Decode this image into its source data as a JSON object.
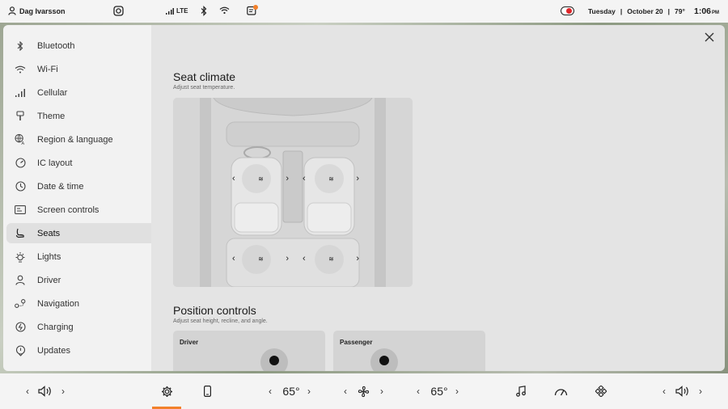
{
  "status": {
    "user": "Dag Ivarsson",
    "signal": "LTE",
    "date_day": "Tuesday",
    "date_sep1": "|",
    "date": "October 20",
    "date_sep2": "|",
    "temp": "79°",
    "time": "1:06",
    "time_suffix": "PM"
  },
  "sidebar": {
    "items": [
      {
        "label": "Bluetooth",
        "icon": "bluetooth-icon"
      },
      {
        "label": "Wi-Fi",
        "icon": "wifi-icon"
      },
      {
        "label": "Cellular",
        "icon": "cellular-icon"
      },
      {
        "label": "Theme",
        "icon": "theme-icon"
      },
      {
        "label": "Region & language",
        "icon": "region-language-icon"
      },
      {
        "label": "IC layout",
        "icon": "ic-layout-icon"
      },
      {
        "label": "Date & time",
        "icon": "clock-icon"
      },
      {
        "label": "Screen controls",
        "icon": "screen-controls-icon"
      },
      {
        "label": "Seats",
        "icon": "seat-icon"
      },
      {
        "label": "Lights",
        "icon": "light-icon"
      },
      {
        "label": "Driver",
        "icon": "driver-icon"
      },
      {
        "label": "Navigation",
        "icon": "navigation-icon"
      },
      {
        "label": "Charging",
        "icon": "charging-icon"
      },
      {
        "label": "Updates",
        "icon": "updates-icon"
      }
    ],
    "active": "Seats"
  },
  "main": {
    "seat_climate_title": "Seat climate",
    "seat_climate_sub": "Adjust seat temperature.",
    "position_title": "Position controls",
    "position_sub": "Adjust seat height, recline, and angle.",
    "driver_label": "Driver",
    "passenger_label": "Passenger",
    "heat_glyph": "≋"
  },
  "bottom": {
    "left_temp": "65°",
    "right_temp": "65°"
  },
  "colors": {
    "accent": "#f2802a",
    "record": "#e0262a"
  }
}
